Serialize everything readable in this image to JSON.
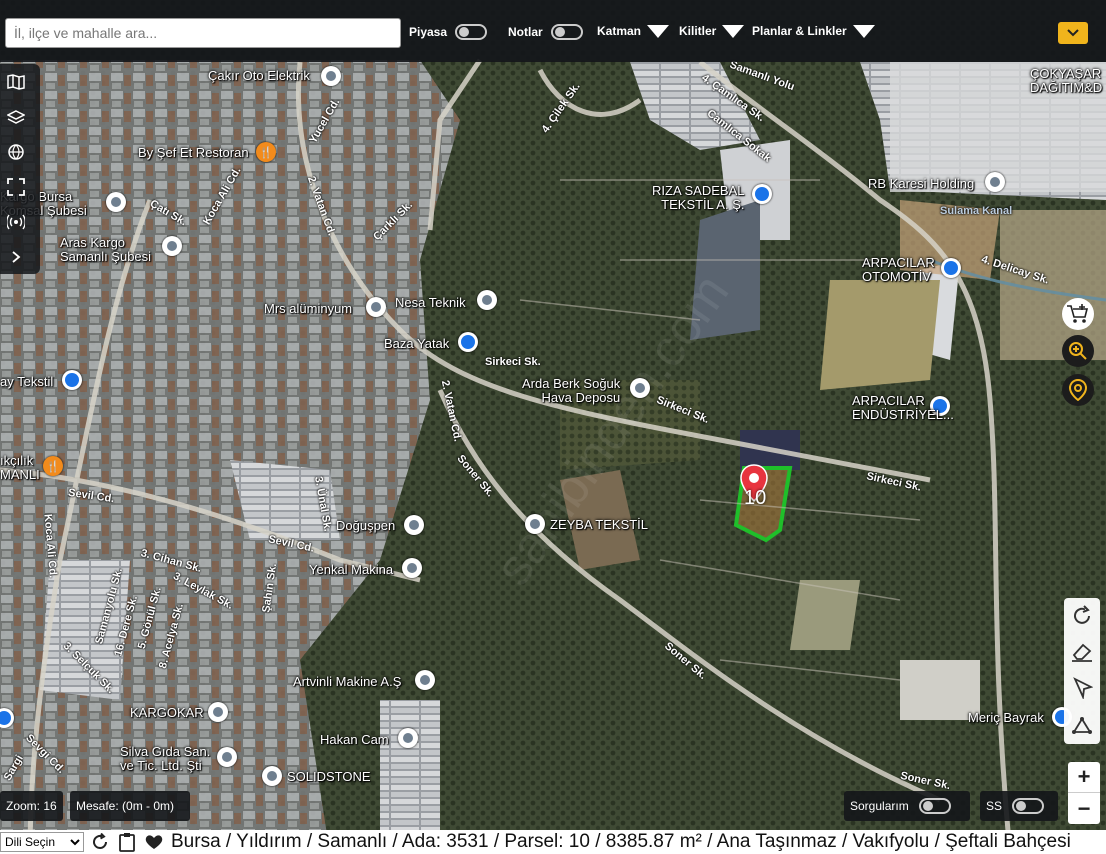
{
  "search": {
    "placeholder": "İl, ilçe ve mahalle ara..."
  },
  "toolbar": {
    "toggles": [
      {
        "label": "Piyasa",
        "on": false
      },
      {
        "label": "Notlar",
        "on": false
      }
    ],
    "dropdowns": [
      "Katman",
      "Kilitler",
      "Planlar & Linkler"
    ],
    "accent_color": "#f0b41c"
  },
  "left_tools": [
    "map-book-icon",
    "layers-icon",
    "globe-icon",
    "fullscreen-icon",
    "broadcast-icon",
    "chevron-right-icon"
  ],
  "right_tools": [
    "add-cart-icon",
    "zoom-search-icon",
    "location-pin-icon"
  ],
  "edit_tools": [
    "rotate-icon",
    "eraser-icon",
    "pointer-icon",
    "measure-icon"
  ],
  "zoom_controls": {
    "in": "+",
    "out": "−"
  },
  "map": {
    "places": [
      {
        "name": "Çakır Oto Elektrik",
        "type": "gray"
      },
      {
        "name": "By Şef Et Restoran",
        "type": "orange"
      },
      {
        "name": "Kargo Bursa\nKomsal Şubesi",
        "type": "gray"
      },
      {
        "name": "Aras Kargo\nSamanlı Şubesi",
        "type": "gray"
      },
      {
        "name": "Mrs alüminyum",
        "type": "gray"
      },
      {
        "name": "Nesa Teknik",
        "type": "gray"
      },
      {
        "name": "Baza Yatak",
        "type": "blue"
      },
      {
        "name": "ay Tekstil",
        "type": "blue"
      },
      {
        "name": "Arda Berk Soğuk\nHava Deposu",
        "type": "gray"
      },
      {
        "name": "RIZA SADEBAL\nTEKSTİL A. Ş.",
        "type": "blue"
      },
      {
        "name": "RB Karesi Holding",
        "type": "gray"
      },
      {
        "name": "ARPACILAR\nOTOMOTİV",
        "type": "blue"
      },
      {
        "name": "ARPACILAR\nENDÜSTRİYEL...",
        "type": "blue"
      },
      {
        "name": "ÇOKYAŞAR\nDAĞITIM&D",
        "type": "none"
      },
      {
        "name": "ıkçılık\nMANLI",
        "type": "orange"
      },
      {
        "name": "Doğuşpen",
        "type": "gray"
      },
      {
        "name": "ZEYBA TEKSTİL",
        "type": "gray"
      },
      {
        "name": "Yenkal Makina",
        "type": "gray"
      },
      {
        "name": "Artvinli Makine A.Ş",
        "type": "gray"
      },
      {
        "name": "KARGOKAR",
        "type": "gray"
      },
      {
        "name": "Hakan Cam",
        "type": "gray"
      },
      {
        "name": "Silva Gıda San.\nve Tic. Ltd. Şti",
        "type": "gray"
      },
      {
        "name": "SOLIDSTONE",
        "type": "gray"
      },
      {
        "name": "Meriç Bayrak",
        "type": "blue"
      }
    ],
    "streets": [
      "4. Çamlıca Sk.",
      "Camlıca Sokak",
      "Samanlı Yolu",
      "Yucel Cd.",
      "4. Çilek Sk.",
      "Koca Ali Cd.",
      "Çatı Sk.",
      "2. Vatan Cd.",
      "Çarklı Sk.",
      "Sulama Kanal",
      "4. Delicay Sk.",
      "Sirkeci Sk.",
      "Sirkeci Sk.",
      "Sirkeci Sk.",
      "2. Vatan Cd.",
      "Soner Sk.",
      "Soner Sk.",
      "Soner Sk.",
      "Sevil Cd.",
      "Sevil Cd.",
      "3. Ünal Sk.",
      "Koca Ali Cd.",
      "3. Cihan Sk.",
      "3. Leylak Sk.",
      "Samanyolu Sk.",
      "16. Dere Sk.",
      "5. Gönül Sk.",
      "8. Acelya Sk.",
      "3. Selçuk Sk.",
      "Şahin Sk.",
      "Sevgi Cd.",
      "Sargi"
    ],
    "parcel": {
      "number": "10",
      "outline_color": "#1fbf2a",
      "marker_color": "#e8343f"
    },
    "watermark": "sahibinden.com"
  },
  "status": {
    "zoom": "Zoom: 16",
    "distance": "Mesafe: (0m - 0m)",
    "queries": {
      "label": "Sorgularım",
      "on": false
    },
    "ss": {
      "label": "SS",
      "on": false
    }
  },
  "bottom": {
    "language": "Dili Seçin",
    "breadcrumb": "Bursa / Yıldırım / Samanlı / Ada: 3531 / Parsel: 10 / 8385.87 m² / Ana Taşınmaz / Vakıfyolu / Şeftali Bahçesi"
  }
}
